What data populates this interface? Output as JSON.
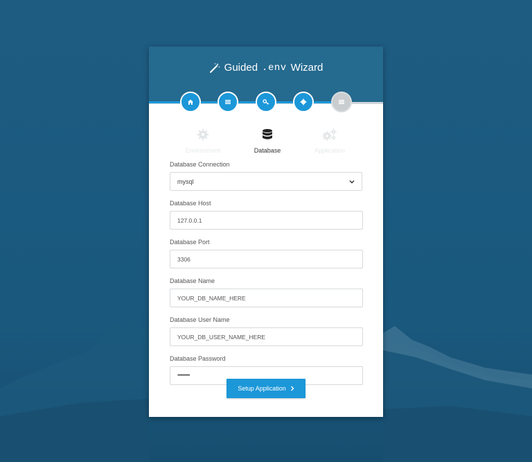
{
  "header": {
    "title_prefix": "Guided",
    "title_code": ".env",
    "title_suffix": "Wizard"
  },
  "steps": [
    {
      "icon": "home-icon",
      "state": "active"
    },
    {
      "icon": "list-icon",
      "state": "active"
    },
    {
      "icon": "key-icon",
      "state": "active"
    },
    {
      "icon": "cog-icon",
      "state": "active"
    },
    {
      "icon": "list-icon",
      "state": "inactive"
    }
  ],
  "tabs": [
    {
      "label": "Environment",
      "icon": "gear-icon",
      "active": false
    },
    {
      "label": "Database",
      "icon": "database-icon",
      "active": true
    },
    {
      "label": "Application",
      "icon": "gears-icon",
      "active": false
    }
  ],
  "form": {
    "connection": {
      "label": "Database Connection",
      "value": "mysql"
    },
    "host": {
      "label": "Database Host",
      "value": "127.0.0.1"
    },
    "port": {
      "label": "Database Port",
      "value": "3306"
    },
    "name": {
      "label": "Database Name",
      "value": "YOUR_DB_NAME_HERE"
    },
    "user": {
      "label": "Database User Name",
      "value": "YOUR_DB_USER_NAME_HERE"
    },
    "password": {
      "label": "Database Password",
      "value": "••••••••••••"
    }
  },
  "submit": {
    "label": "Setup Application"
  },
  "colors": {
    "accent": "#1c97d8",
    "header": "#256a8f",
    "background": "#1b5a80",
    "inactive_step": "#c9cdd0"
  }
}
